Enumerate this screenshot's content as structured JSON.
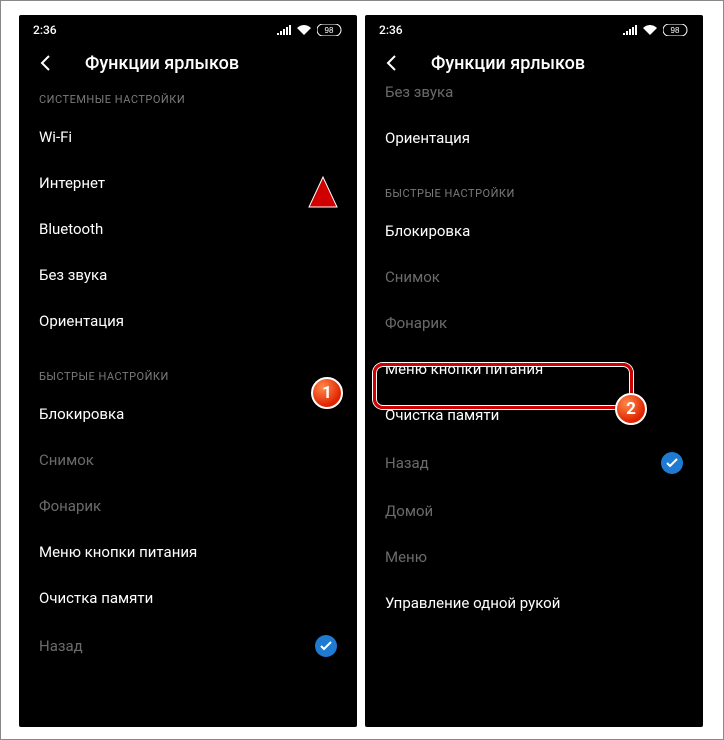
{
  "status": {
    "time": "2:36",
    "battery": "98"
  },
  "header": {
    "title": "Функции ярлыков"
  },
  "screen1": {
    "section1_label": "СИСТЕМНЫЕ НАСТРОЙКИ",
    "items1": {
      "wifi": "Wi-Fi",
      "internet": "Интернет",
      "bluetooth": "Bluetooth",
      "silent": "Без звука",
      "orientation": "Ориентация"
    },
    "section2_label": "БЫСТРЫЕ НАСТРОЙКИ",
    "items2": {
      "lock": "Блокировка",
      "screenshot": "Снимок",
      "flashlight": "Фонарик",
      "powermenu": "Меню кнопки питания",
      "clearmem": "Очистка памяти",
      "back": "Назад"
    }
  },
  "screen2": {
    "cut_item": "Без звука",
    "orientation": "Ориентация",
    "section_label": "БЫСТРЫЕ НАСТРОЙКИ",
    "items": {
      "lock": "Блокировка",
      "screenshot": "Снимок",
      "flashlight": "Фонарик",
      "powermenu": "Меню кнопки питания",
      "clearmem": "Очистка памяти",
      "back": "Назад",
      "home": "Домой",
      "menu": "Меню",
      "onehand": "Управление одной рукой"
    }
  },
  "annotations": {
    "badge1": "1",
    "badge2": "2"
  }
}
